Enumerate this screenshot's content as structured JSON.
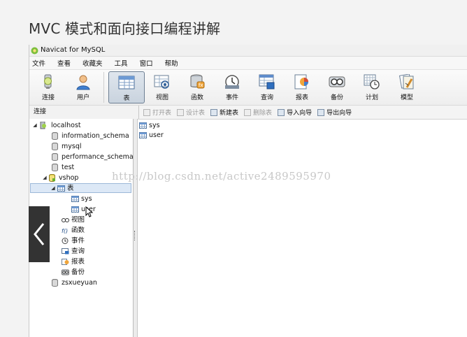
{
  "slide_title": "MVC 模式和面向接口编程讲解",
  "window": {
    "title": "Navicat for MySQL"
  },
  "menu": [
    "文件",
    "查看",
    "收藏夹",
    "工具",
    "窗口",
    "帮助"
  ],
  "toolbar": [
    {
      "label": "连接",
      "icon": "connection-icon"
    },
    {
      "label": "用户",
      "icon": "user-icon"
    },
    {
      "label": "表",
      "icon": "table-icon"
    },
    {
      "label": "视图",
      "icon": "view-icon"
    },
    {
      "label": "函数",
      "icon": "function-icon"
    },
    {
      "label": "事件",
      "icon": "event-icon"
    },
    {
      "label": "查询",
      "icon": "query-icon"
    },
    {
      "label": "报表",
      "icon": "report-icon"
    },
    {
      "label": "备份",
      "icon": "backup-icon"
    },
    {
      "label": "计划",
      "icon": "schedule-icon"
    },
    {
      "label": "模型",
      "icon": "model-icon"
    }
  ],
  "connection_label": "连接",
  "object_actions": [
    {
      "label": "打开表",
      "enabled": false
    },
    {
      "label": "设计表",
      "enabled": false
    },
    {
      "label": "新建表",
      "enabled": true
    },
    {
      "label": "删除表",
      "enabled": false
    },
    {
      "label": "导入向导",
      "enabled": true
    },
    {
      "label": "导出向导",
      "enabled": true
    }
  ],
  "tree": {
    "root": "localhost",
    "databases": [
      "information_schema",
      "mysql",
      "performance_schema",
      "test"
    ],
    "active_db": "vshop",
    "table_group": "表",
    "tables": [
      "sys",
      "user"
    ],
    "other_groups": [
      "视图",
      "函数",
      "事件",
      "查询",
      "报表",
      "备份"
    ],
    "last_db": "zsxueyuan"
  },
  "content_tables": [
    "sys",
    "user"
  ],
  "watermark": "http://blog.csdn.net/active2489595970",
  "colors": {
    "selection": "#dce8f6",
    "active_button": "#c9d3de",
    "watermark": "#c8c8c8"
  }
}
